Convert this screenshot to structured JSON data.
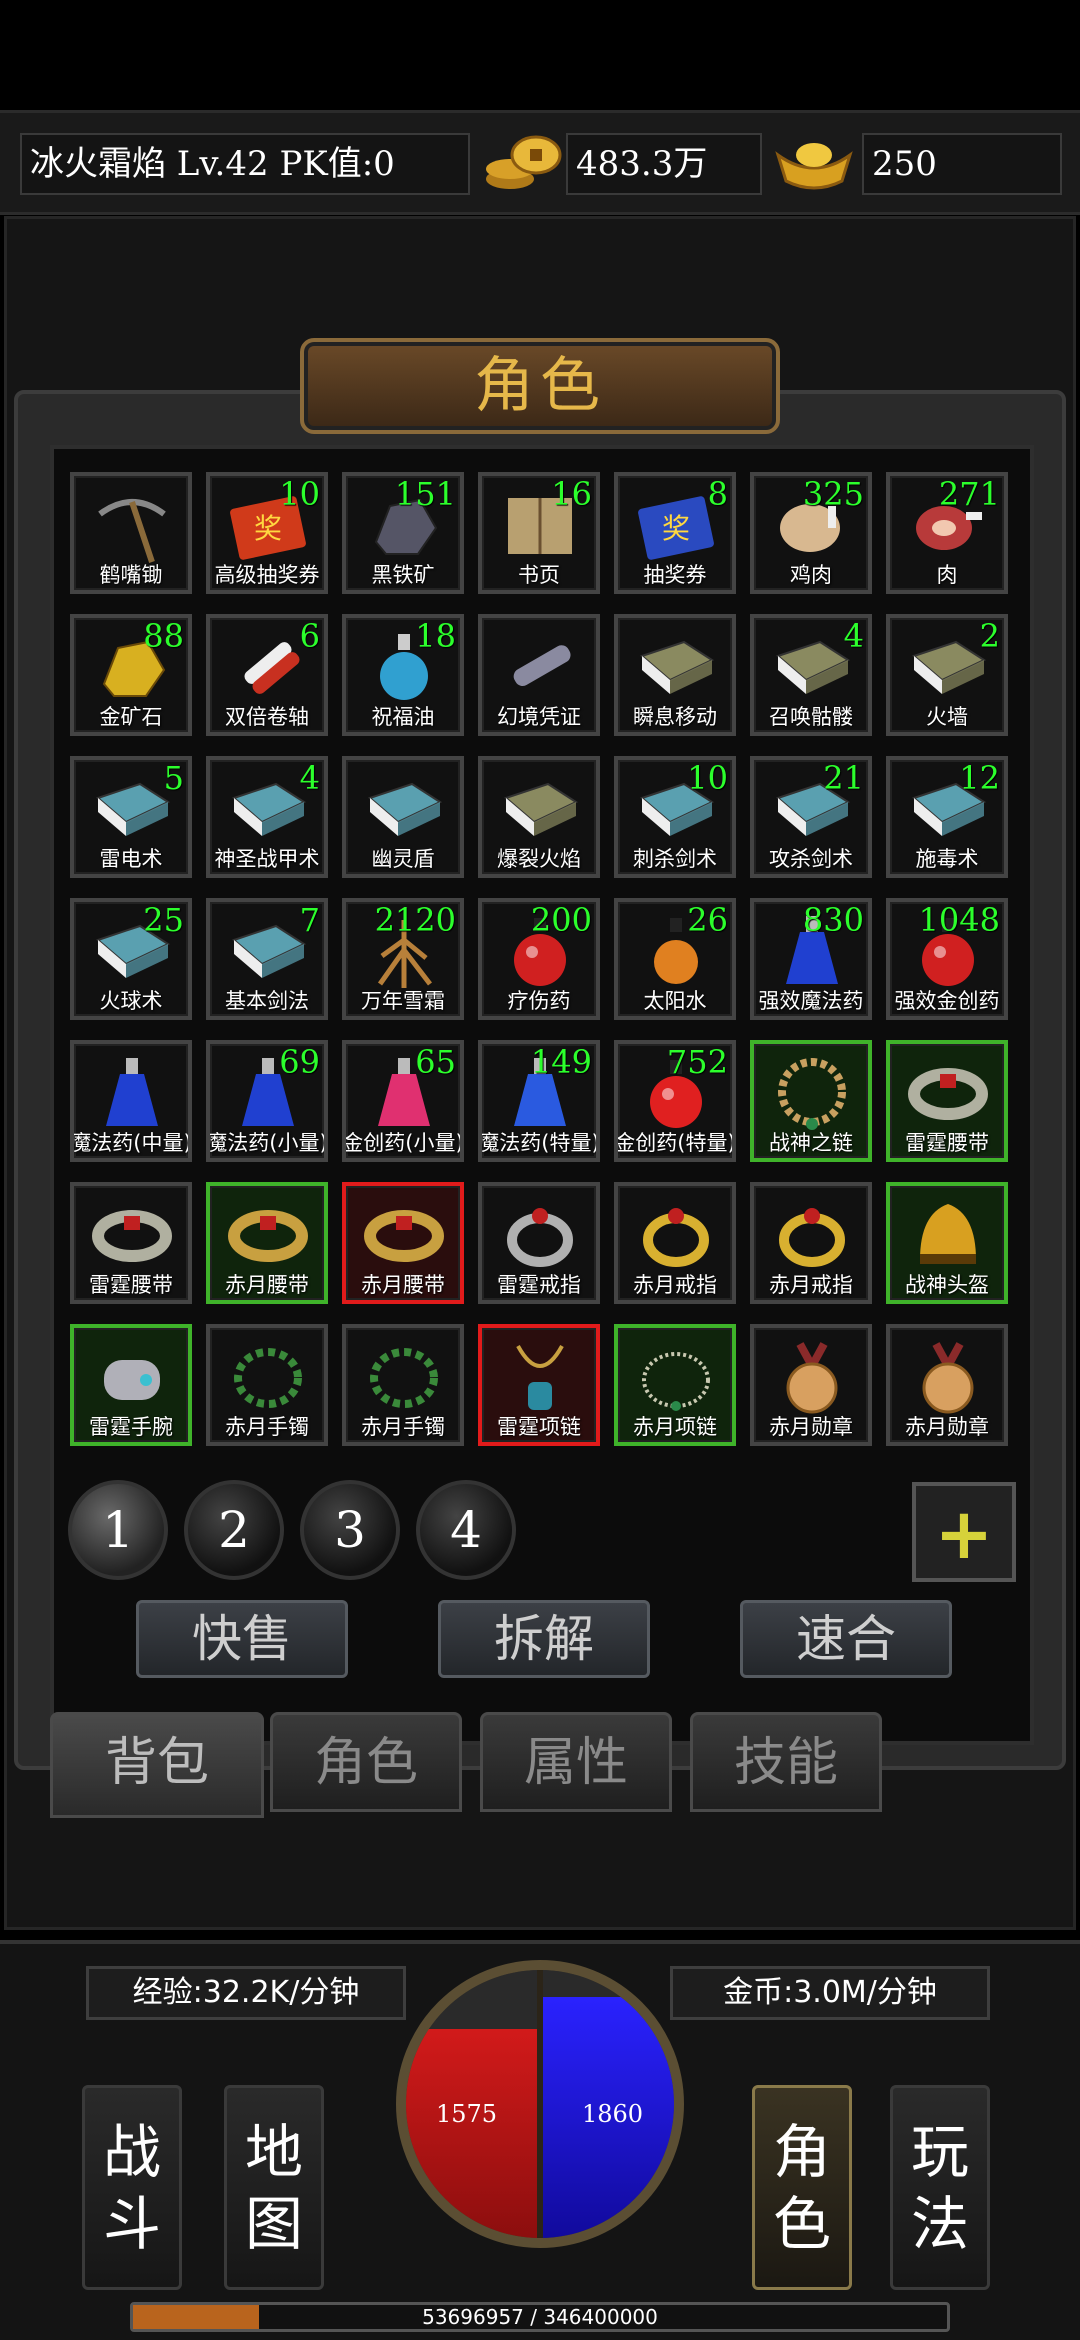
{
  "top": {
    "player": "冰火霜焰  Lv.42 PK值:0",
    "gold": "483.3万",
    "ingots": "250"
  },
  "panel_title": "角色",
  "items": [
    {
      "name": "鹤嘴锄",
      "count": "",
      "icon": "pickaxe-icon",
      "c": "#8a6a3a",
      "b": ""
    },
    {
      "name": "高级抽奖券",
      "count": "10",
      "icon": "red-lottery-ticket-icon",
      "c": "#d03a1a",
      "b": ""
    },
    {
      "name": "黑铁矿",
      "count": "151",
      "icon": "iron-ore-icon",
      "c": "#555566",
      "b": ""
    },
    {
      "name": "书页",
      "count": "16",
      "icon": "book-page-icon",
      "c": "#b8a070",
      "b": ""
    },
    {
      "name": "抽奖券",
      "count": "8",
      "icon": "blue-lottery-ticket-icon",
      "c": "#2a4ac0",
      "b": ""
    },
    {
      "name": "鸡肉",
      "count": "325",
      "icon": "chicken-icon",
      "c": "#d8b890",
      "b": ""
    },
    {
      "name": "肉",
      "count": "271",
      "icon": "meat-icon",
      "c": "#b83a3a",
      "b": ""
    },
    {
      "name": "金矿石",
      "count": "88",
      "icon": "gold-ore-icon",
      "c": "#d8b020",
      "b": ""
    },
    {
      "name": "双倍卷轴",
      "count": "6",
      "icon": "scroll-icon",
      "c": "#c83020",
      "b": ""
    },
    {
      "name": "祝福油",
      "count": "18",
      "icon": "potion-flask-icon",
      "c": "#30a0d0",
      "b": ""
    },
    {
      "name": "幻境凭证",
      "count": "",
      "icon": "voucher-scroll-icon",
      "c": "#8a8aa0",
      "b": ""
    },
    {
      "name": "瞬息移动",
      "count": "",
      "icon": "skill-book-icon",
      "c": "#8a8a60",
      "b": ""
    },
    {
      "name": "召唤骷髅",
      "count": "4",
      "icon": "skill-book-icon",
      "c": "#8a8a60",
      "b": ""
    },
    {
      "name": "火墙",
      "count": "2",
      "icon": "skill-book-icon",
      "c": "#8a8a60",
      "b": ""
    },
    {
      "name": "雷电术",
      "count": "5",
      "icon": "skill-book-icon",
      "c": "#5aa0b0",
      "b": ""
    },
    {
      "name": "神圣战甲术",
      "count": "4",
      "icon": "skill-book-icon",
      "c": "#5aa0b0",
      "b": ""
    },
    {
      "name": "幽灵盾",
      "count": "",
      "icon": "skill-book-icon",
      "c": "#5aa0b0",
      "b": ""
    },
    {
      "name": "爆裂火焰",
      "count": "",
      "icon": "skill-book-icon",
      "c": "#8a8a60",
      "b": ""
    },
    {
      "name": "刺杀剑术",
      "count": "10",
      "icon": "skill-book-icon",
      "c": "#5aa0b0",
      "b": ""
    },
    {
      "name": "攻杀剑术",
      "count": "21",
      "icon": "skill-book-icon",
      "c": "#5aa0b0",
      "b": ""
    },
    {
      "name": "施毒术",
      "count": "12",
      "icon": "skill-book-icon",
      "c": "#5aa0b0",
      "b": ""
    },
    {
      "name": "火球术",
      "count": "25",
      "icon": "skill-book-icon",
      "c": "#5aa0b0",
      "b": ""
    },
    {
      "name": "基本剑法",
      "count": "7",
      "icon": "skill-book-icon",
      "c": "#5aa0b0",
      "b": ""
    },
    {
      "name": "万年雪霜",
      "count": "2120",
      "icon": "ginseng-root-icon",
      "c": "#b8803a",
      "b": ""
    },
    {
      "name": "疗伤药",
      "count": "200",
      "icon": "red-potion-icon",
      "c": "#d02020",
      "b": ""
    },
    {
      "name": "太阳水",
      "count": "26",
      "icon": "orange-potion-icon",
      "c": "#e08020",
      "b": ""
    },
    {
      "name": "强效魔法药",
      "count": "830",
      "icon": "blue-potion-icon",
      "c": "#2040d0",
      "b": ""
    },
    {
      "name": "强效金创药",
      "count": "1048",
      "icon": "red-potion-icon",
      "c": "#d02020",
      "b": ""
    },
    {
      "name": "魔法药(中量)",
      "count": "",
      "icon": "blue-potion-icon",
      "c": "#2040d0",
      "b": ""
    },
    {
      "name": "魔法药(小量)",
      "count": "69",
      "icon": "blue-potion-icon",
      "c": "#2040d0",
      "b": ""
    },
    {
      "name": "金创药(小量)",
      "count": "65",
      "icon": "pink-potion-icon",
      "c": "#e03070",
      "b": ""
    },
    {
      "name": "魔法药(特量)",
      "count": "149",
      "icon": "blue-potion-icon",
      "c": "#2a5ae0",
      "b": ""
    },
    {
      "name": "金创药(特量)",
      "count": "752",
      "icon": "red-potion-icon",
      "c": "#e02020",
      "b": ""
    },
    {
      "name": "战神之链",
      "count": "",
      "icon": "bead-necklace-icon",
      "c": "#c8a060",
      "b": "green"
    },
    {
      "name": "雷霆腰带",
      "count": "",
      "icon": "belt-icon",
      "c": "#b0b0a0",
      "b": "green"
    },
    {
      "name": "雷霆腰带",
      "count": "",
      "icon": "belt-icon",
      "c": "#b0b0a0",
      "b": ""
    },
    {
      "name": "赤月腰带",
      "count": "",
      "icon": "belt-icon",
      "c": "#c8a040",
      "b": "green"
    },
    {
      "name": "赤月腰带",
      "count": "",
      "icon": "belt-icon",
      "c": "#c8a040",
      "b": "red"
    },
    {
      "name": "雷霆戒指",
      "count": "",
      "icon": "ring-icon",
      "c": "#b0b0b0",
      "b": ""
    },
    {
      "name": "赤月戒指",
      "count": "",
      "icon": "ring-icon",
      "c": "#d8b030",
      "b": ""
    },
    {
      "name": "赤月戒指",
      "count": "",
      "icon": "ring-icon",
      "c": "#d8b030",
      "b": ""
    },
    {
      "name": "战神头盔",
      "count": "",
      "icon": "helmet-icon",
      "c": "#d8a020",
      "b": "green"
    },
    {
      "name": "雷霆手腕",
      "count": "",
      "icon": "bracer-icon",
      "c": "#b0b0b8",
      "b": "green"
    },
    {
      "name": "赤月手镯",
      "count": "",
      "icon": "bead-bracelet-icon",
      "c": "#3a8a3a",
      "b": ""
    },
    {
      "name": "赤月手镯",
      "count": "",
      "icon": "bead-bracelet-icon",
      "c": "#3a8a3a",
      "b": ""
    },
    {
      "name": "雷霆项链",
      "count": "",
      "icon": "pendant-necklace-icon",
      "c": "#c8a040",
      "b": "red"
    },
    {
      "name": "赤月项链",
      "count": "",
      "icon": "chain-necklace-icon",
      "c": "#c8c8b0",
      "b": "green"
    },
    {
      "name": "赤月勋章",
      "count": "",
      "icon": "medal-icon",
      "c": "#d8a060",
      "b": ""
    },
    {
      "name": "赤月勋章",
      "count": "",
      "icon": "medal-icon",
      "c": "#d8a060",
      "b": ""
    }
  ],
  "pages": [
    "1",
    "2",
    "3",
    "4"
  ],
  "actions": {
    "quick_sell": "快售",
    "dismantle": "拆解",
    "quick_merge": "速合"
  },
  "tabs": {
    "bag": "背包",
    "role": "角色",
    "attr": "属性",
    "skill": "技能"
  },
  "rates": {
    "exp": "经验:32.2K/分钟",
    "gold": "金币:3.0M/分钟"
  },
  "hp": "1575",
  "mp": "1860",
  "nav": {
    "fight": "战斗",
    "map": "地图",
    "role": "角色",
    "play": "玩法"
  },
  "xp": {
    "text": "53696957 / 346400000",
    "fraction": 0.155
  }
}
